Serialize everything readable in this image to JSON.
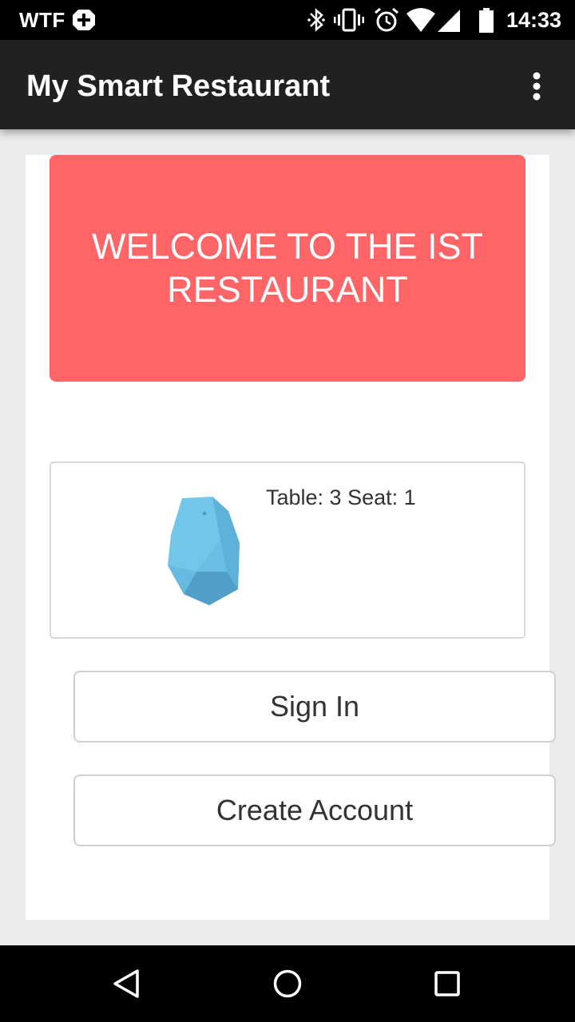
{
  "status_bar": {
    "carrier": "WTF",
    "time": "14:33",
    "icons": [
      "plus-box-icon",
      "bluetooth-icon",
      "vibrate-icon",
      "alarm-icon",
      "wifi-icon",
      "signal-icon",
      "battery-icon"
    ]
  },
  "app_bar": {
    "title": "My Smart Restaurant",
    "overflow_icon": "more-vert-icon"
  },
  "welcome": {
    "text": "WELCOME TO THE IST RESTAURANT",
    "color": "#ff6566"
  },
  "beacon": {
    "icon": "beacon-icon",
    "info": "Table: 3 Seat: 1"
  },
  "actions": {
    "sign_in": "Sign In",
    "create_account": "Create Account"
  },
  "nav_bar": {
    "icons": [
      "back-icon",
      "home-icon",
      "recents-icon"
    ]
  }
}
